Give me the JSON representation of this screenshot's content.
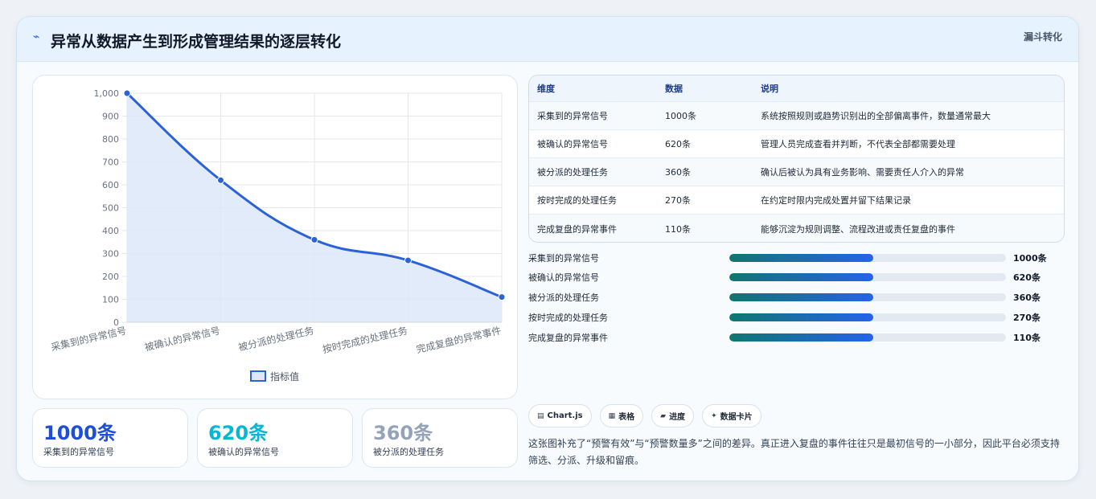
{
  "header": {
    "icon": "trend-icon",
    "title": "异常从数据产生到形成管理结果的逐层转化",
    "tag": "漏斗转化"
  },
  "chart_data": {
    "type": "area",
    "categories": [
      "采集到的异常信号",
      "被确认的异常信号",
      "被分派的处理任务",
      "按时完成的处理任务",
      "完成复盘的异常事件"
    ],
    "series": [
      {
        "name": "指标值",
        "values": [
          1000,
          620,
          360,
          270,
          110
        ]
      }
    ],
    "ylim": [
      0,
      1000
    ],
    "yticks": [
      "0",
      "100",
      "200",
      "300",
      "400",
      "500",
      "600",
      "700",
      "800",
      "900",
      "1,000"
    ],
    "legend": "bottom",
    "grid": true,
    "colors": {
      "line": "#2c62d8",
      "fill": "#dde7f8"
    }
  },
  "stats": [
    {
      "value": "1000条",
      "label": "采集到的异常信号",
      "color": "#1d4ed8"
    },
    {
      "value": "620条",
      "label": "被确认的异常信号",
      "color": "#06b6d4"
    },
    {
      "value": "360条",
      "label": "被分派的处理任务",
      "color": "#94a3b8"
    }
  ],
  "table": {
    "headers": [
      "维度",
      "数据",
      "说明"
    ],
    "rows": [
      [
        "采集到的异常信号",
        "1000条",
        "系统按照规则或趋势识别出的全部偏离事件，数量通常最大"
      ],
      [
        "被确认的异常信号",
        "620条",
        "管理人员完成查看并判断，不代表全部都需要处理"
      ],
      [
        "被分派的处理任务",
        "360条",
        "确认后被认为具有业务影响、需要责任人介入的异常"
      ],
      [
        "按时完成的处理任务",
        "270条",
        "在约定时限内完成处置并留下结果记录"
      ],
      [
        "完成复盘的异常事件",
        "110条",
        "能够沉淀为规则调整、流程改进或责任复盘的事件"
      ]
    ]
  },
  "progress": [
    {
      "label": "采集到的异常信号",
      "value": "1000条",
      "fill": 0.52
    },
    {
      "label": "被确认的异常信号",
      "value": "620条",
      "fill": 0.52
    },
    {
      "label": "被分派的处理任务",
      "value": "360条",
      "fill": 0.52
    },
    {
      "label": "按时完成的处理任务",
      "value": "270条",
      "fill": 0.52
    },
    {
      "label": "完成复盘的异常事件",
      "value": "110条",
      "fill": 0.52
    }
  ],
  "chips": [
    {
      "icon": "chart-icon",
      "glyph": "▤",
      "label": "Chart.js"
    },
    {
      "icon": "table-icon",
      "glyph": "▦",
      "label": "表格"
    },
    {
      "icon": "progress-icon",
      "glyph": "▰",
      "label": "进度"
    },
    {
      "icon": "sparkle-icon",
      "glyph": "✦",
      "label": "数据卡片"
    }
  ],
  "description": "这张图补充了“预警有效”与“预警数量多”之间的差异。真正进入复盘的事件往往只是最初信号的一小部分，因此平台必须支持筛选、分派、升级和留痕。"
}
